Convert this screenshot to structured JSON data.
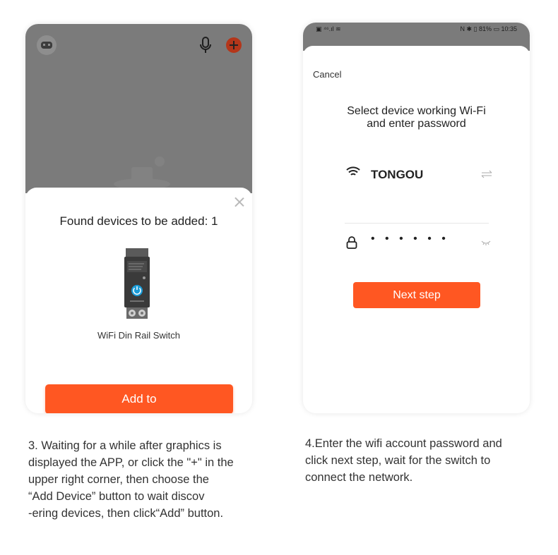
{
  "left_screen": {
    "sheet": {
      "title": "Found devices to be added: 1",
      "device_name": "WiFi Din Rail Switch",
      "add_button": "Add to"
    }
  },
  "right_screen": {
    "status_bar": {
      "left": "▣ ⁴⁶.ıl ≋",
      "right": "N ✱ ▯ 81% ▭ 10:35",
      "battery": "81%",
      "time": "10:35"
    },
    "cancel_label": "Cancel",
    "title_line1": "Select device working Wi-Fi",
    "title_line2": "and enter password",
    "wifi_name": "TONGOU",
    "password_masked": "• • • • • •",
    "next_button": "Next step"
  },
  "captions": {
    "step3_line1": "3. Waiting for a while after graphics is",
    "step3_line2": "displayed the APP, or click the \"+\" in the",
    "step3_line3": "upper right corner, then choose the",
    "step3_line4": "“Add Device” button to wait discov",
    "step3_line5": "-ering devices, then click“Add” button.",
    "step4_line1": "4.Enter the wifi account password and",
    "step4_line2": "click next step, wait for the switch to",
    "step4_line3": "connect the network."
  },
  "colors": {
    "accent": "#ff5722",
    "overlay": "#7b7b7b",
    "device_body": "#3a3a3a",
    "power_button": "#1a9bd7"
  }
}
